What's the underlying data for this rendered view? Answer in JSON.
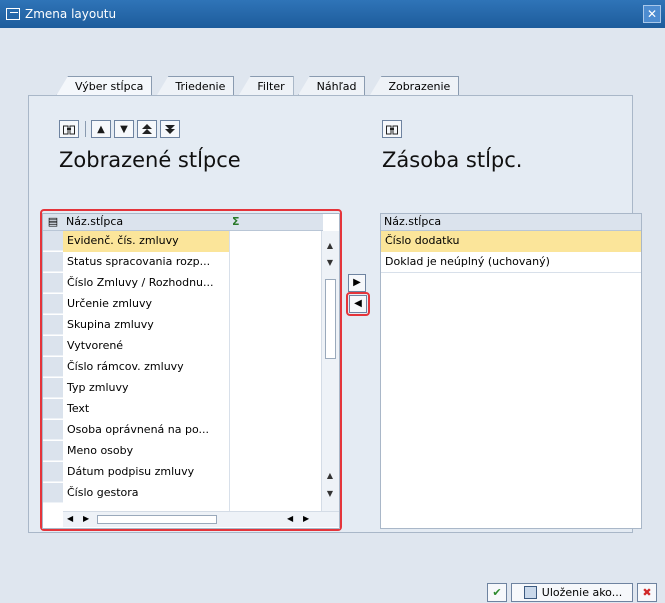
{
  "window": {
    "title": "Zmena layoutu",
    "close_glyph": "✕"
  },
  "tabs": [
    {
      "label": "Výber stĺpca",
      "active": true
    },
    {
      "label": "Triedenie",
      "active": false
    },
    {
      "label": "Filter",
      "active": false
    },
    {
      "label": "Náhľad",
      "active": false
    },
    {
      "label": "Zobrazenie",
      "active": false
    }
  ],
  "left_panel": {
    "toolbar": [
      "find-icon",
      "move-up-icon",
      "move-down-icon",
      "move-top-icon",
      "move-bottom-icon"
    ],
    "title": "Zobrazené stĺpce",
    "column_header": "Náz.stĺpca",
    "sum_header": "Σ",
    "rows": [
      {
        "label": "Evidenč. čís. zmluvy",
        "selected": true
      },
      {
        "label": "Status spracovania rozp...",
        "selected": false
      },
      {
        "label": "Číslo Zmluvy / Rozhodnu...",
        "selected": false
      },
      {
        "label": "Určenie zmluvy",
        "selected": false
      },
      {
        "label": "Skupina zmluvy",
        "selected": false
      },
      {
        "label": "Vytvorené",
        "selected": false
      },
      {
        "label": "Číslo rámcov. zmluvy",
        "selected": false
      },
      {
        "label": "Typ zmluvy",
        "selected": false
      },
      {
        "label": "Text",
        "selected": false
      },
      {
        "label": "Osoba oprávnená na po...",
        "selected": false
      },
      {
        "label": "Meno osoby",
        "selected": false
      },
      {
        "label": "Dátum podpisu zmluvy",
        "selected": false
      },
      {
        "label": "Číslo gestora",
        "selected": false
      }
    ]
  },
  "right_panel": {
    "toolbar": [
      "find-icon"
    ],
    "title": "Zásoba stĺpc.",
    "column_header": "Náz.stĺpca",
    "rows": [
      {
        "label": "Číslo dodatku",
        "selected": true
      },
      {
        "label": "Doklad je neúplný (uchovaný)",
        "selected": false
      }
    ]
  },
  "footer": {
    "save_as_label": "Uloženie ako..."
  },
  "colors": {
    "highlight": "#e4343a",
    "selection": "#fbe59a",
    "title_bar": "#1d5c9c"
  }
}
